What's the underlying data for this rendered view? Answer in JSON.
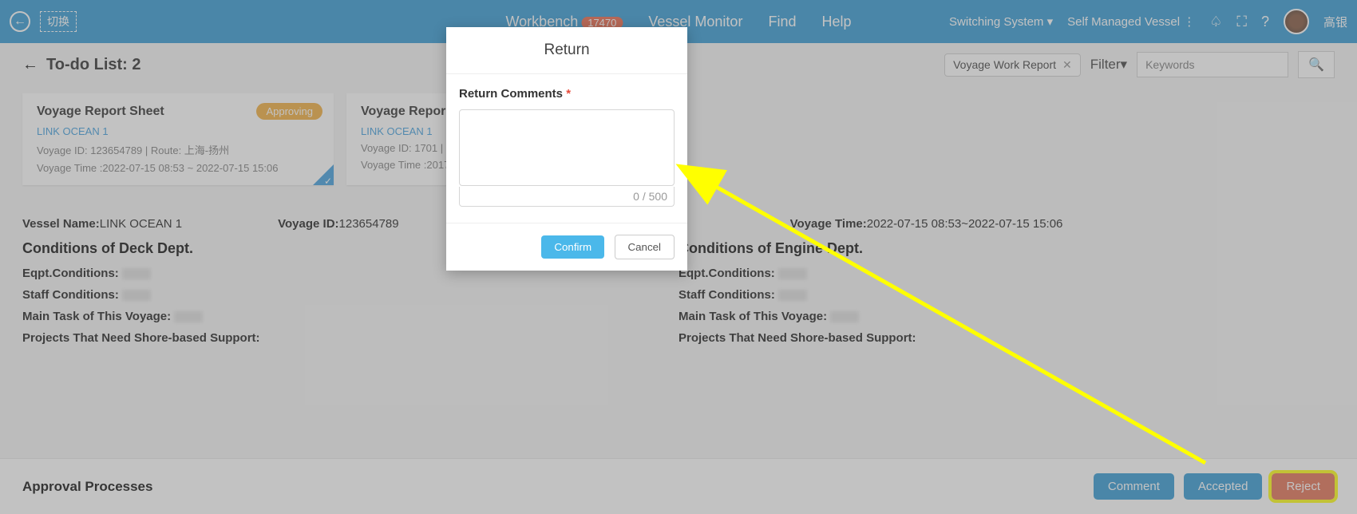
{
  "topbar": {
    "swap": "切换",
    "nav": {
      "workbench": "Workbench",
      "workbench_badge": "17470",
      "vessel_monitor": "Vessel Monitor",
      "find": "Find",
      "help": "Help"
    },
    "right": {
      "switching": "Switching System",
      "self_managed": "Self Managed Vessel",
      "user": "高银"
    }
  },
  "title": "To-do List: 2",
  "filter": {
    "tag": "Voyage Work Report",
    "filter_label": "Filter",
    "keywords_placeholder": "Keywords"
  },
  "cards": [
    {
      "title": "Voyage Report Sheet",
      "status": "Approving",
      "vessel": "LINK OCEAN 1",
      "line1": "Voyage ID:  123654789 | Route:  上海-扬州",
      "line2": "Voyage Time :2022-07-15 08:53 ~ 2022-07-15 15:06"
    },
    {
      "title": "Voyage Repor",
      "status": "",
      "vessel": "LINK OCEAN 1",
      "line1": "Voyage ID:  1701 |",
      "line2": "Voyage Time :2017"
    }
  ],
  "detail": {
    "vessel_name_label": "Vessel Name:",
    "vessel_name": "LINK OCEAN 1",
    "voyage_id_label": "Voyage ID:",
    "voyage_id": "123654789",
    "voyage_time_label": "Voyage Time:",
    "voyage_time": "2022-07-15 08:53~2022-07-15 15:06",
    "deck_heading": "Conditions of Deck Dept.",
    "engine_heading": "Conditions of Engine Dept.",
    "rows": {
      "eqpt": "Eqpt.Conditions:",
      "staff": "Staff Conditions:",
      "main": "Main Task of This Voyage:",
      "projects": "Projects That Need Shore-based Support:"
    }
  },
  "footer": {
    "heading": "Approval Processes",
    "comment": "Comment",
    "accepted": "Accepted",
    "reject": "Reject"
  },
  "modal": {
    "title": "Return",
    "label": "Return Comments",
    "counter": "0 / 500",
    "confirm": "Confirm",
    "cancel": "Cancel"
  }
}
